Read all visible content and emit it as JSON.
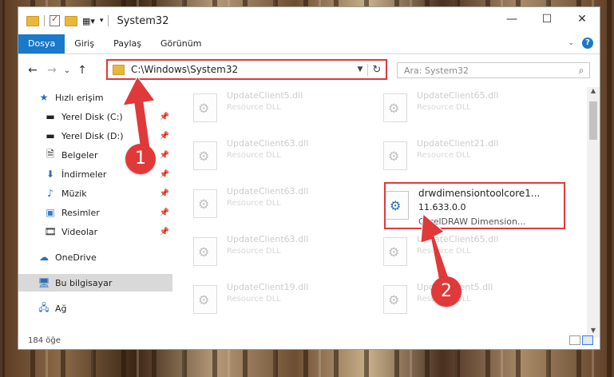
{
  "window": {
    "title": "System32"
  },
  "ribbon": {
    "tabs": [
      "Dosya",
      "Giriş",
      "Paylaş",
      "Görünüm"
    ],
    "help": "?"
  },
  "nav": {
    "back": "←",
    "forward": "→",
    "recent": "⌄",
    "up": "↑",
    "address": "C:\\Windows\\System32",
    "refresh": "↻",
    "search_placeholder": "Ara: System32"
  },
  "sidebar": {
    "items": [
      {
        "label": "Hızlı erişim",
        "icon": "star-icon"
      },
      {
        "label": "Yerel Disk (C:)",
        "icon": "drive-icon",
        "pinned": true
      },
      {
        "label": "Yerel Disk (D:)",
        "icon": "drive-icon",
        "pinned": true
      },
      {
        "label": "Belgeler",
        "icon": "documents-icon",
        "pinned": true
      },
      {
        "label": "İndirmeler",
        "icon": "download-icon",
        "pinned": true
      },
      {
        "label": "Müzik",
        "icon": "music-icon",
        "pinned": true
      },
      {
        "label": "Resimler",
        "icon": "pictures-icon",
        "pinned": true
      },
      {
        "label": "Videolar",
        "icon": "videos-icon",
        "pinned": true
      },
      {
        "label": "OneDrive",
        "icon": "cloud-icon"
      },
      {
        "label": "Bu bilgisayar",
        "icon": "computer-icon",
        "selected": true
      },
      {
        "label": "Ağ",
        "icon": "network-icon"
      }
    ]
  },
  "files": [
    {
      "name": "UpdateClient5.dll",
      "type": "Resource DLL"
    },
    {
      "name": "UpdateClient65.dll",
      "type": "Resource DLL"
    },
    {
      "name": "UpdateClient63.dll",
      "type": "Resource DLL"
    },
    {
      "name": "UpdateClient21.dll",
      "type": "Resource DLL"
    },
    {
      "name": "UpdateClient63.dll",
      "type": "Resource DLL"
    },
    {
      "name": "drwdimensiontoolcore1...",
      "version": "11.633.0.0",
      "type": "CorelDRAW Dimension..."
    },
    {
      "name": "UpdateClient63.dll",
      "type": "Resource DLL"
    },
    {
      "name": "UpdateClient65.dll",
      "type": "Resource DLL"
    },
    {
      "name": "UpdateClient19.dll",
      "type": "Resource DLL"
    },
    {
      "name": "UpdateClient5.dll",
      "type": "Resource DLL"
    }
  ],
  "status": {
    "count": "184 öğe"
  },
  "annotations": {
    "badge1": "1",
    "badge2": "2"
  },
  "colors": {
    "accent": "#1979ca",
    "highlight": "#e0393a"
  }
}
